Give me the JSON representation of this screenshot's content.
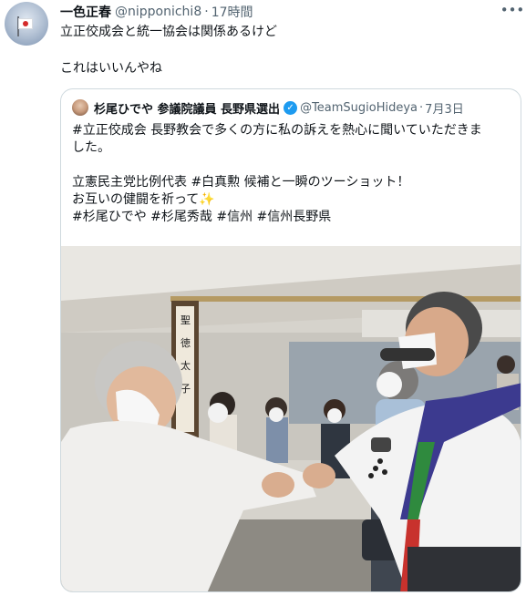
{
  "tweet": {
    "author_name": "一色正春",
    "author_handle": "@nipponichi8",
    "separator": "·",
    "time": "17時間",
    "more_icon": "more-horizontal-icon",
    "lines": [
      "立正佼成会と統一協会は関係あるけど",
      "これはいいんやね"
    ]
  },
  "quoted": {
    "author_name": "杉尾ひでや 参議院議員 長野県選出",
    "verified_glyph": "✓",
    "author_handle": "@TeamSugioHideya",
    "separator": "·",
    "date": "7月3日",
    "line1": "#立正佼成会 長野教会で多くの方に私の訴えを熱心に聞いていただきま",
    "line2": "した。",
    "line3": "立憲民主党比例代表 #白真勲 候補と一瞬のツーショット！",
    "line4": "お互いの健闘を祈って",
    "sparkle": "✨",
    "line5": "#杉尾ひでや #杉尾秀哉 #信州 #信州長野県"
  },
  "colors": {
    "text": "#0f1419",
    "secondary": "#536471",
    "border": "#cfd9de",
    "verified": "#1d9bf0"
  }
}
